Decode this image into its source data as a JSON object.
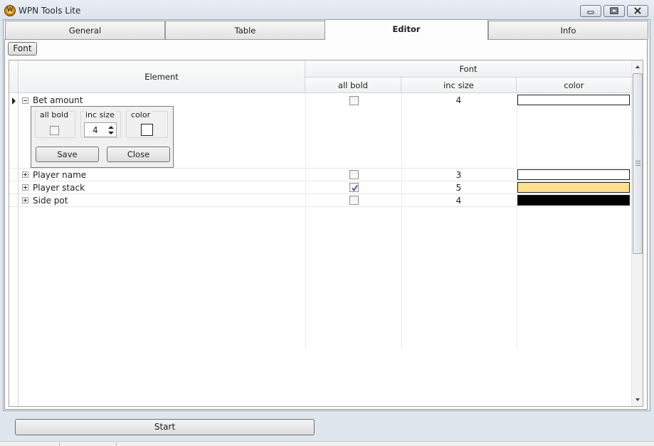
{
  "window": {
    "title": "WPN Tools Lite",
    "app_icon_letter": "W"
  },
  "tabs": [
    {
      "label": "General",
      "active": false
    },
    {
      "label": "Table",
      "active": false
    },
    {
      "label": "Editor",
      "active": true
    },
    {
      "label": "Info",
      "active": false
    }
  ],
  "toolbar": {
    "font_button": "Font"
  },
  "grid": {
    "headers": {
      "element": "Element",
      "font_group": "Font",
      "all_bold": "all bold",
      "inc_size": "inc size",
      "color": "color"
    },
    "rows": [
      {
        "name": "Bet amount",
        "expanded": true,
        "all_bold": false,
        "inc_size": "4",
        "color": "#ffffff"
      },
      {
        "name": "Player name",
        "expanded": false,
        "all_bold": false,
        "inc_size": "3",
        "color": "#ffffff"
      },
      {
        "name": "Player stack",
        "expanded": false,
        "all_bold": true,
        "inc_size": "5",
        "color": "#ffe08e"
      },
      {
        "name": "Side pot",
        "expanded": false,
        "all_bold": false,
        "inc_size": "4",
        "color": "#000000"
      }
    ],
    "detail": {
      "all_bold_label": "all bold",
      "inc_size_label": "inc size",
      "inc_size_value": "4",
      "color_label": "color",
      "color_value": "#ffffff",
      "save_button": "Save",
      "close_button": "Close"
    }
  },
  "footer": {
    "start_button": "Start"
  }
}
